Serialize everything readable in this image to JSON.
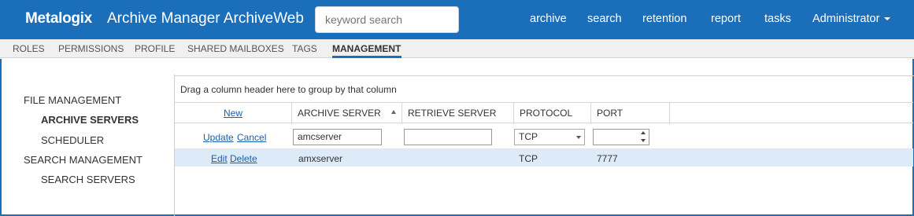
{
  "header": {
    "logo": "Metalogix",
    "app_title": "Archive Manager ArchiveWeb",
    "search_placeholder": "keyword search",
    "nav": [
      "archive",
      "search",
      "retention",
      "report",
      "tasks"
    ],
    "user_menu": "Administrator"
  },
  "tabs": [
    "ROLES",
    "PERMISSIONS",
    "PROFILE",
    "SHARED MAILBOXES",
    "TAGS",
    "MANAGEMENT"
  ],
  "active_tab": "MANAGEMENT",
  "sidebar": {
    "file_management": "FILE MANAGEMENT",
    "archive_servers": "ARCHIVE SERVERS",
    "scheduler": "SCHEDULER",
    "search_management": "SEARCH MANAGEMENT",
    "search_servers": "SEARCH SERVERS"
  },
  "grid": {
    "group_panel_text": "Drag a column header here to group by that column",
    "new_link": "New",
    "columns": [
      "ARCHIVE SERVER",
      "RETRIEVE SERVER",
      "PROTOCOL",
      "PORT"
    ],
    "sort_column": "ARCHIVE SERVER",
    "edit_row": {
      "update": "Update",
      "cancel": "Cancel",
      "archive_server_value": "amcserver",
      "retrieve_server_value": "",
      "protocol_value": "TCP",
      "port_value": ""
    },
    "rows": [
      {
        "edit": "Edit",
        "delete": "Delete",
        "archive_server": "amxserver",
        "retrieve_server": "",
        "protocol": "TCP",
        "port": "7777"
      }
    ]
  },
  "colors": {
    "brand_blue": "#1b6fba",
    "selected_row": "#ddebf8",
    "link": "#1b5fa8"
  }
}
